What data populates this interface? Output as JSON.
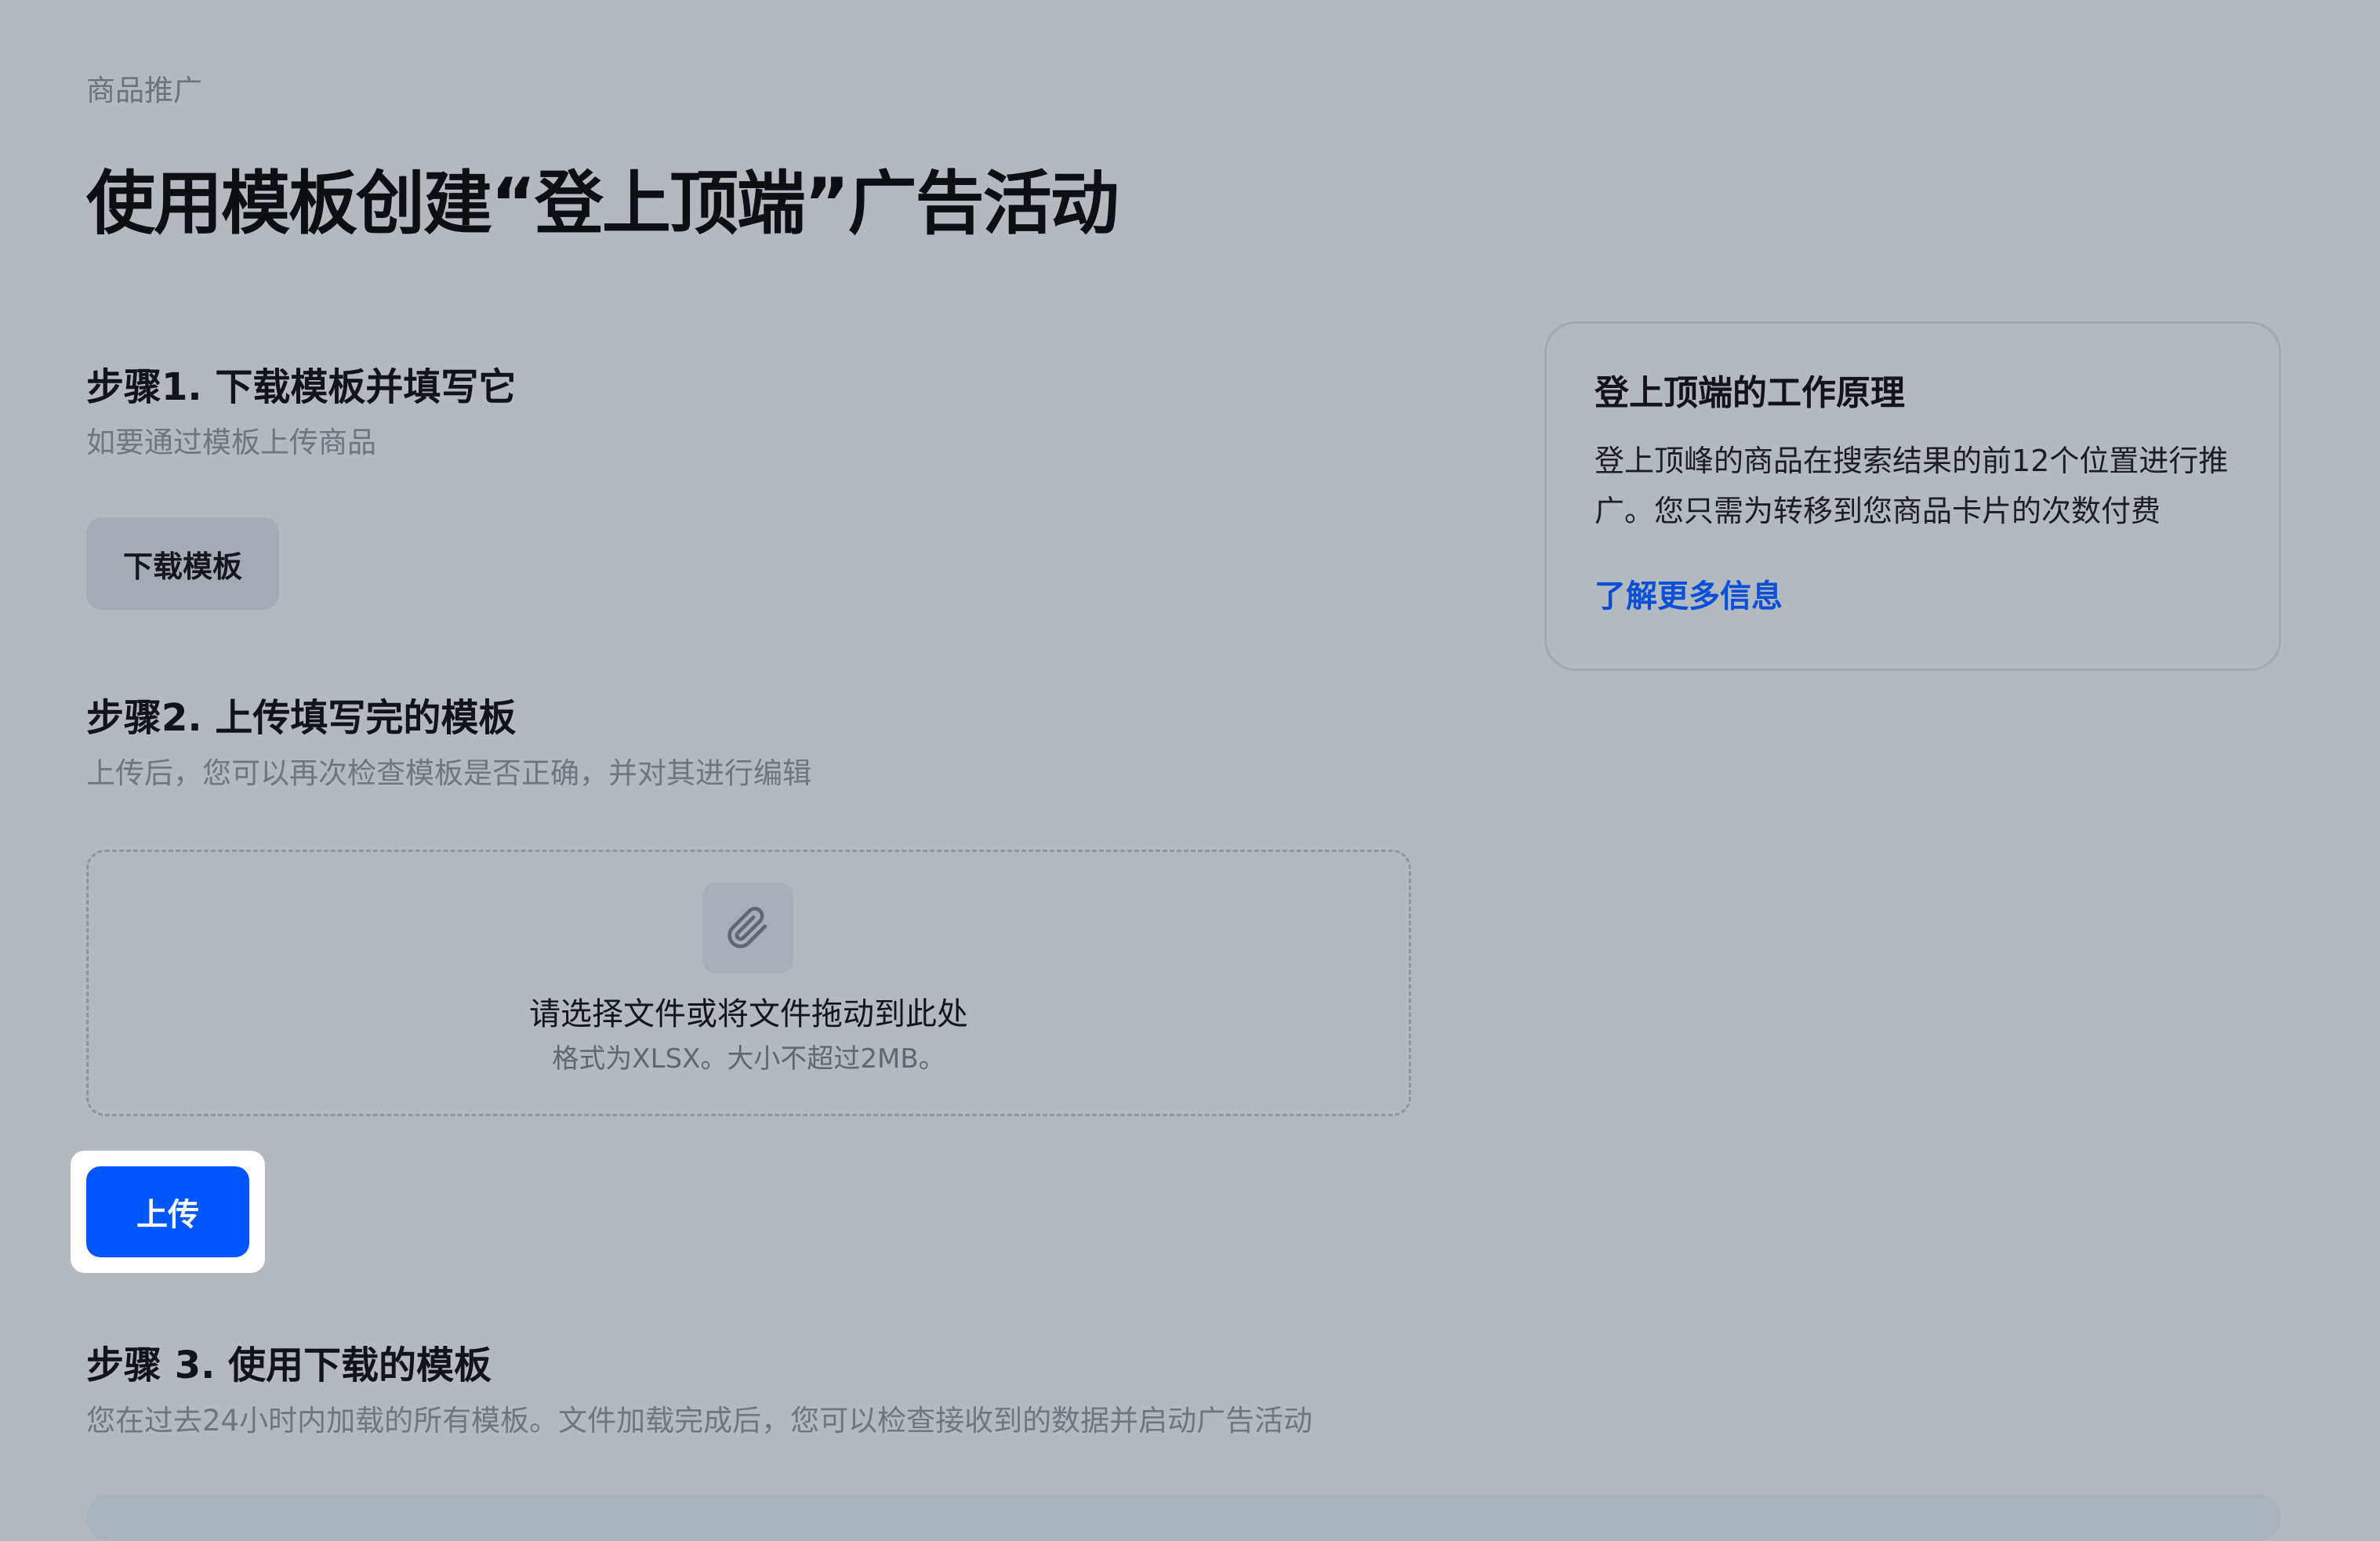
{
  "header": {
    "breadcrumb": "商品推广",
    "title": "使用模板创建“登上顶端”广告活动"
  },
  "step1": {
    "heading": "步骤1. 下载模板并填写它",
    "description": "如要通过模板上传商品",
    "download_button": "下载模板"
  },
  "step2": {
    "heading": "步骤2. 上传填写完的模板",
    "description": "上传后，您可以再次检查模板是否正确，并对其进行编辑",
    "dropzone": {
      "icon": "paperclip-icon",
      "title": "请选择文件或将文件拖动到此处",
      "hint": "格式为XLSX。大小不超过2MB。"
    },
    "upload_button": "上传"
  },
  "step3": {
    "heading": "步骤 3. 使用下载的模板",
    "description": "您在过去24小时内加载的所有模板。文件加载完成后，您可以检查接收到的数据并启动广告活动"
  },
  "info_card": {
    "title": "登上顶端的工作原理",
    "body": "登上顶峰的商品在搜索结果的前12个位置进行推广。您只需为转移到您商品卡片的次数付费",
    "link": "了解更多信息"
  },
  "colors": {
    "background": "#b2b9c1",
    "primary": "#0057ff",
    "link": "#0a4fd6"
  }
}
